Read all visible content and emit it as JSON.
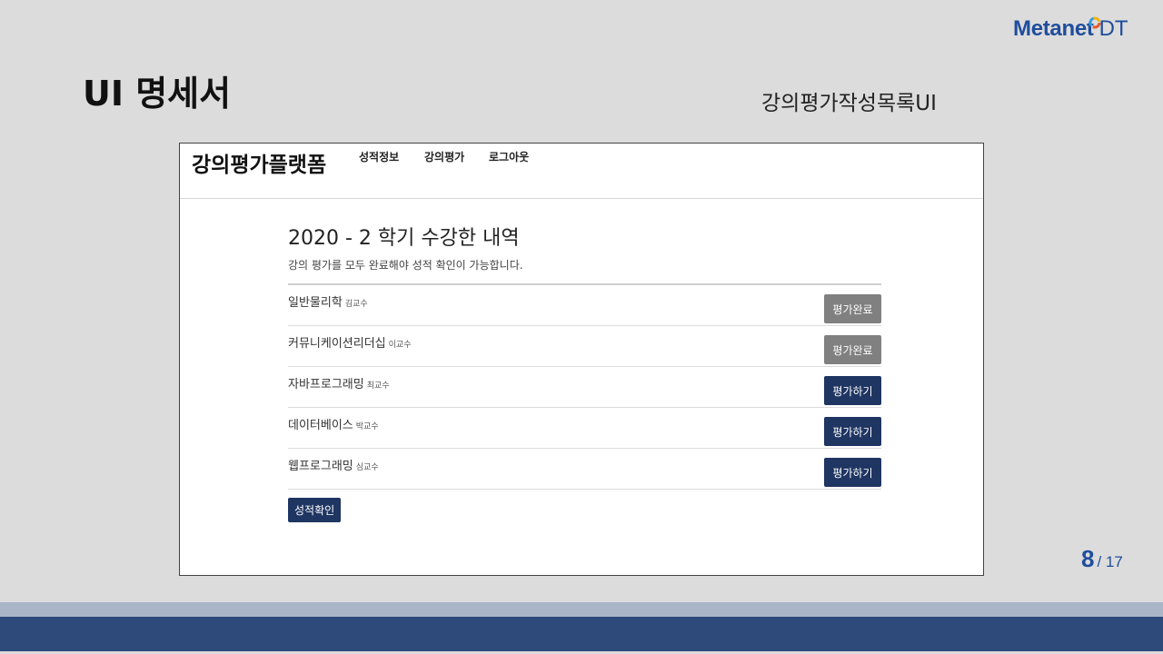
{
  "slide": {
    "logo_main": "Metanet",
    "logo_dt": "DT",
    "title": "UI 명세서",
    "subtitle": "강의평가작성목록UI",
    "page_current": "8",
    "page_total": "/ 17"
  },
  "app": {
    "brand": "강의평가플랫폼",
    "nav": [
      "성적정보",
      "강의평가",
      "로그아웃"
    ],
    "heading": "2020 - 2 학기 수강한 내역",
    "description": "강의 평가를 모두 완료해야 성적 확인이 가능합니다.",
    "courses": [
      {
        "name": "일반물리학",
        "professor": "김교수",
        "action": "평가완료",
        "status": "done"
      },
      {
        "name": "커뮤니케이션리더십",
        "professor": "이교수",
        "action": "평가완료",
        "status": "done"
      },
      {
        "name": "자바프로그래밍",
        "professor": "최교수",
        "action": "평가하기",
        "status": "todo"
      },
      {
        "name": "데이터베이스",
        "professor": "박교수",
        "action": "평가하기",
        "status": "todo"
      },
      {
        "name": "웹프로그래밍",
        "professor": "심교수",
        "action": "평가하기",
        "status": "todo"
      }
    ],
    "grade_button": "성적확인"
  },
  "colors": {
    "brand_blue": "#1f4e9c",
    "button_navy": "#1f3562",
    "button_done": "#808080",
    "band_dark": "#2e4a7a",
    "band_light": "#aab6c8"
  }
}
